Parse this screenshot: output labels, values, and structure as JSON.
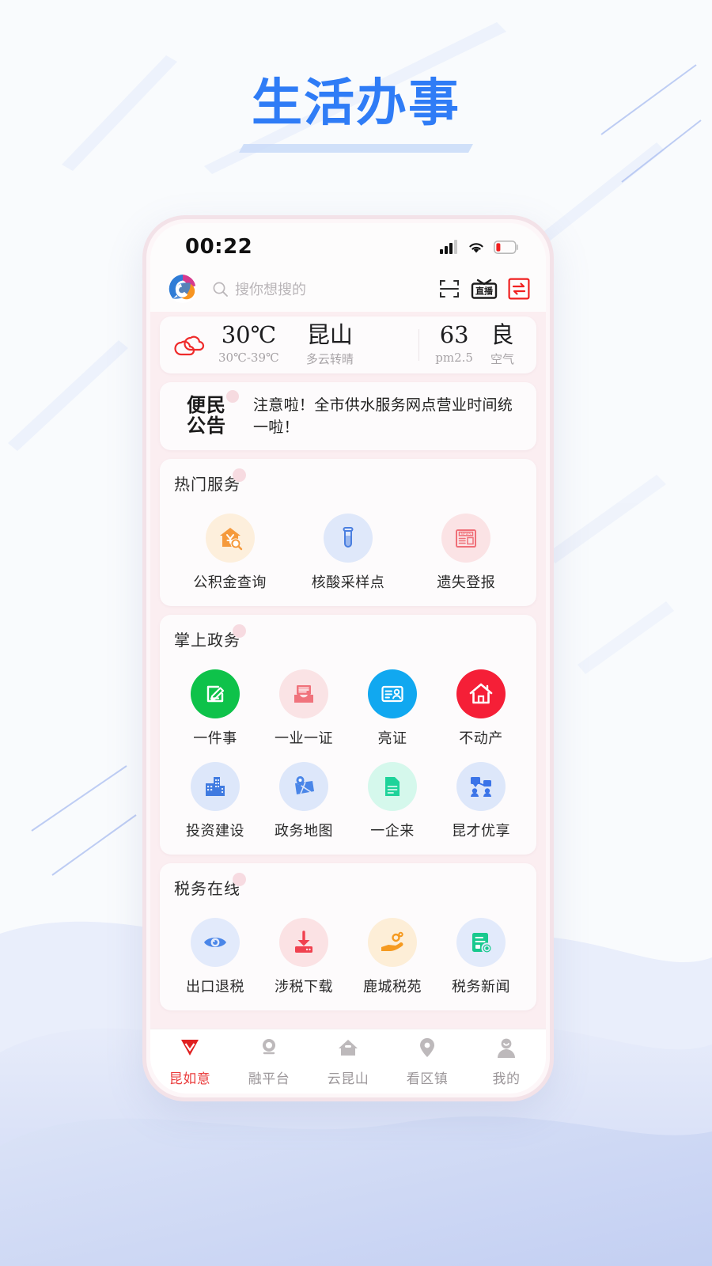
{
  "page": {
    "title": "生活办事"
  },
  "phone": {
    "status": {
      "time": "00:22",
      "signal_icon": "cellular-signal-icon",
      "wifi_icon": "wifi-icon",
      "battery_icon": "battery-low-icon"
    },
    "header": {
      "logo_icon": "app-logo-icon",
      "search_icon": "search-icon",
      "search_placeholder": "搜你想搜的",
      "scan_icon": "scan-icon",
      "live_label": "直播",
      "live_icon": "live-broadcast-icon",
      "exchange_icon": "exchange-icon"
    },
    "weather": {
      "icon": "cloudy-icon",
      "temp": "30℃",
      "temp_range": "30℃-39℃",
      "city": "昆山",
      "condition": "多云转晴",
      "pm_value": "63",
      "pm_label": "pm2.5",
      "air_level": "良",
      "air_label": "空气"
    },
    "announcement": {
      "badge_line1": "便民",
      "badge_line2": "公告",
      "text": "注意啦！全市供水服务网点营业时间统一啦！"
    },
    "sections": [
      {
        "title": "热门服务",
        "columns": 3,
        "items": [
          {
            "label": "公积金查询",
            "icon": "house-money-search-icon",
            "bg": "#fdefdc",
            "color": "#f59a3c"
          },
          {
            "label": "核酸采样点",
            "icon": "test-tube-icon",
            "bg": "#dfe8fa",
            "color": "#4a7fe0"
          },
          {
            "label": "遗失登报",
            "icon": "newspaper-icon",
            "bg": "#fbe3e5",
            "color": "#ef6f78"
          }
        ]
      },
      {
        "title": "掌上政务",
        "columns": 4,
        "items": [
          {
            "label": "一件事",
            "icon": "edit-document-icon",
            "bg": "#0ec24a",
            "color": "#ffffff"
          },
          {
            "label": "一业一证",
            "icon": "license-tray-icon",
            "bg": "#fae3e5",
            "color": "#f0737c"
          },
          {
            "label": "亮证",
            "icon": "id-card-icon",
            "bg": "#11a8f0",
            "color": "#ffffff"
          },
          {
            "label": "不动产",
            "icon": "real-estate-house-icon",
            "bg": "#f51f37",
            "color": "#ffffff"
          },
          {
            "label": "投资建设",
            "icon": "buildings-icon",
            "bg": "#dde7fa",
            "color": "#3f7ae0"
          },
          {
            "label": "政务地图",
            "icon": "map-pin-icon",
            "bg": "#dde7fa",
            "color": "#4a86e8"
          },
          {
            "label": "一企来",
            "icon": "document-green-icon",
            "bg": "#d5f8ec",
            "color": "#1ed39a"
          },
          {
            "label": "昆才优享",
            "icon": "talent-network-icon",
            "bg": "#dde7fa",
            "color": "#3b74e8"
          }
        ]
      },
      {
        "title": "税务在线",
        "columns": 4,
        "items": [
          {
            "label": "出口退税",
            "icon": "eye-export-icon",
            "bg": "#e2eafb",
            "color": "#4a86e8"
          },
          {
            "label": "涉税下载",
            "icon": "download-box-icon",
            "bg": "#fbe2e4",
            "color": "#f0414f"
          },
          {
            "label": "鹿城税苑",
            "icon": "hand-coin-icon",
            "bg": "#fdeed7",
            "color": "#f59a20"
          },
          {
            "label": "税务新闻",
            "icon": "tax-news-icon",
            "bg": "#e2eafb",
            "color": "#18c98e"
          }
        ]
      }
    ],
    "tabs": [
      {
        "label": "昆如意",
        "icon": "diamond-icon",
        "active": true
      },
      {
        "label": "融平台",
        "icon": "platform-icon",
        "active": false
      },
      {
        "label": "云昆山",
        "icon": "cloud-home-icon",
        "active": false
      },
      {
        "label": "看区镇",
        "icon": "location-pin-icon",
        "active": false
      },
      {
        "label": "我的",
        "icon": "user-profile-icon",
        "active": false
      }
    ]
  },
  "colors": {
    "title_blue": "#2f7cf6",
    "accent_red": "#ea3c3c",
    "app_bg_pink": "#fbeef1"
  }
}
